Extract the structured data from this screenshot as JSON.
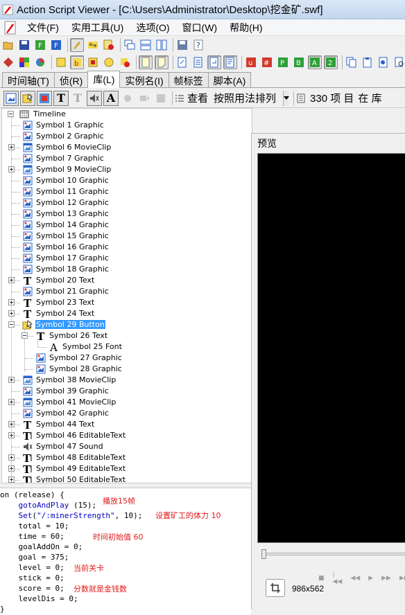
{
  "window": {
    "title": "Action Script Viewer - [C:\\Users\\Administrator\\Desktop\\挖金矿.swf]"
  },
  "menu": [
    "文件(F)",
    "实用工具(U)",
    "选项(O)",
    "窗口(W)",
    "帮助(H)"
  ],
  "toolbar_row2_letters": [
    "u",
    "#",
    "P",
    "B",
    "A",
    "2"
  ],
  "tabs": [
    {
      "label": "时间轴(T)",
      "active": false
    },
    {
      "label": "侦(R)",
      "active": false
    },
    {
      "label": "库(L)",
      "active": true
    },
    {
      "label": "实例名(I)",
      "active": false
    },
    {
      "label": "帧标签",
      "active": false
    },
    {
      "label": "脚本(A)",
      "active": false
    }
  ],
  "library_bar": {
    "view_label": "查看",
    "sort_value": "按照用法排列",
    "count_text": "330 项 目",
    "trailing_text": "在 库"
  },
  "tree": {
    "root": "Timeline",
    "items": [
      {
        "label": "Symbol 1 Graphic",
        "icon": "graphic-icon",
        "level": 1,
        "expander": "none"
      },
      {
        "label": "Symbol 2 Graphic",
        "icon": "graphic-icon",
        "level": 1,
        "expander": "none"
      },
      {
        "label": "Symbol 6 MovieClip",
        "icon": "movieclip-icon",
        "level": 1,
        "expander": "plus"
      },
      {
        "label": "Symbol 7 Graphic",
        "icon": "graphic-icon",
        "level": 1,
        "expander": "none"
      },
      {
        "label": "Symbol 9 MovieClip",
        "icon": "movieclip-icon",
        "level": 1,
        "expander": "plus"
      },
      {
        "label": "Symbol 10 Graphic",
        "icon": "graphic-icon",
        "level": 1,
        "expander": "none"
      },
      {
        "label": "Symbol 11 Graphic",
        "icon": "graphic-icon",
        "level": 1,
        "expander": "none"
      },
      {
        "label": "Symbol 12 Graphic",
        "icon": "graphic-icon",
        "level": 1,
        "expander": "none"
      },
      {
        "label": "Symbol 13 Graphic",
        "icon": "graphic-icon",
        "level": 1,
        "expander": "none"
      },
      {
        "label": "Symbol 14 Graphic",
        "icon": "graphic-icon",
        "level": 1,
        "expander": "none"
      },
      {
        "label": "Symbol 15 Graphic",
        "icon": "graphic-icon",
        "level": 1,
        "expander": "none"
      },
      {
        "label": "Symbol 16 Graphic",
        "icon": "graphic-icon",
        "level": 1,
        "expander": "none"
      },
      {
        "label": "Symbol 17 Graphic",
        "icon": "graphic-icon",
        "level": 1,
        "expander": "none"
      },
      {
        "label": "Symbol 18 Graphic",
        "icon": "graphic-icon",
        "level": 1,
        "expander": "none"
      },
      {
        "label": "Symbol 20 Text",
        "icon": "text-icon",
        "level": 1,
        "expander": "plus"
      },
      {
        "label": "Symbol 21 Graphic",
        "icon": "graphic-icon",
        "level": 1,
        "expander": "none"
      },
      {
        "label": "Symbol 23 Text",
        "icon": "text-icon",
        "level": 1,
        "expander": "plus"
      },
      {
        "label": "Symbol 24 Text",
        "icon": "text-icon",
        "level": 1,
        "expander": "plus"
      },
      {
        "label": "Symbol 29 Button",
        "icon": "button-icon",
        "level": 1,
        "expander": "minus",
        "selected": true
      },
      {
        "label": "Symbol 26 Text",
        "icon": "text-icon",
        "level": 2,
        "expander": "minus"
      },
      {
        "label": "Symbol 25 Font",
        "icon": "font-icon",
        "level": 3,
        "expander": "none"
      },
      {
        "label": "Symbol 27 Graphic",
        "icon": "graphic-icon",
        "level": 2,
        "expander": "none"
      },
      {
        "label": "Symbol 28 Graphic",
        "icon": "graphic-icon",
        "level": 2,
        "expander": "none"
      },
      {
        "label": "Symbol 38 MovieClip",
        "icon": "movieclip-icon",
        "level": 1,
        "expander": "plus"
      },
      {
        "label": "Symbol 39 Graphic",
        "icon": "graphic-icon",
        "level": 1,
        "expander": "none"
      },
      {
        "label": "Symbol 41 MovieClip",
        "icon": "movieclip-icon",
        "level": 1,
        "expander": "plus"
      },
      {
        "label": "Symbol 42 Graphic",
        "icon": "graphic-icon",
        "level": 1,
        "expander": "none"
      },
      {
        "label": "Symbol 44 Text",
        "icon": "text-icon",
        "level": 1,
        "expander": "plus"
      },
      {
        "label": "Symbol 46 EditableText",
        "icon": "editabletext-icon",
        "level": 1,
        "expander": "plus"
      },
      {
        "label": "Symbol 47 Sound",
        "icon": "sound-icon",
        "level": 1,
        "expander": "none"
      },
      {
        "label": "Symbol 48 EditableText",
        "icon": "editabletext-icon",
        "level": 1,
        "expander": "plus"
      },
      {
        "label": "Symbol 49 EditableText",
        "icon": "editabletext-icon",
        "level": 1,
        "expander": "plus"
      },
      {
        "label": "Symbol 50 EditableText",
        "icon": "editabletext-icon",
        "level": 1,
        "expander": "plus"
      }
    ]
  },
  "code": {
    "lines": [
      {
        "indent": "",
        "parts": [
          {
            "t": "on (release) {",
            "c": ""
          }
        ]
      },
      {
        "indent": "    ",
        "parts": [
          {
            "t": "gotoAndPlay",
            "c": "kw-fn"
          },
          {
            "t": " (15);",
            "c": ""
          }
        ],
        "comment": "播放15帧"
      },
      {
        "indent": "    ",
        "parts": [
          {
            "t": "Set",
            "c": "kw-fn"
          },
          {
            "t": "(",
            "c": ""
          },
          {
            "t": "\"/:minerStrength\"",
            "c": "str"
          },
          {
            "t": ", 10);",
            "c": ""
          }
        ],
        "comment": "设置矿工的体力 10"
      },
      {
        "indent": "    ",
        "parts": [
          {
            "t": "total = 10;",
            "c": ""
          }
        ]
      },
      {
        "indent": "    ",
        "parts": [
          {
            "t": "time = 60;",
            "c": ""
          }
        ],
        "comment": "时间初始值 60"
      },
      {
        "indent": "    ",
        "parts": [
          {
            "t": "goalAddOn = 0;",
            "c": ""
          }
        ]
      },
      {
        "indent": "    ",
        "parts": [
          {
            "t": "goal = 375;",
            "c": ""
          }
        ]
      },
      {
        "indent": "    ",
        "parts": [
          {
            "t": "level = 0;",
            "c": ""
          }
        ],
        "comment": "当前关卡"
      },
      {
        "indent": "    ",
        "parts": [
          {
            "t": "stick = 0;",
            "c": ""
          }
        ]
      },
      {
        "indent": "    ",
        "parts": [
          {
            "t": "score = 0;",
            "c": ""
          }
        ],
        "comment": "分数就是金钱数"
      },
      {
        "indent": "    ",
        "parts": [
          {
            "t": "levelDis = 0;",
            "c": ""
          }
        ]
      },
      {
        "indent": "",
        "parts": [
          {
            "t": "}",
            "c": ""
          }
        ]
      }
    ]
  },
  "preview": {
    "title": "预览",
    "size_text": "986x562"
  },
  "colors": {
    "selection": "#3399ff",
    "code_keyword": "#0000c0",
    "code_comment": "#e01a1a",
    "preview_bg": "#000000"
  }
}
